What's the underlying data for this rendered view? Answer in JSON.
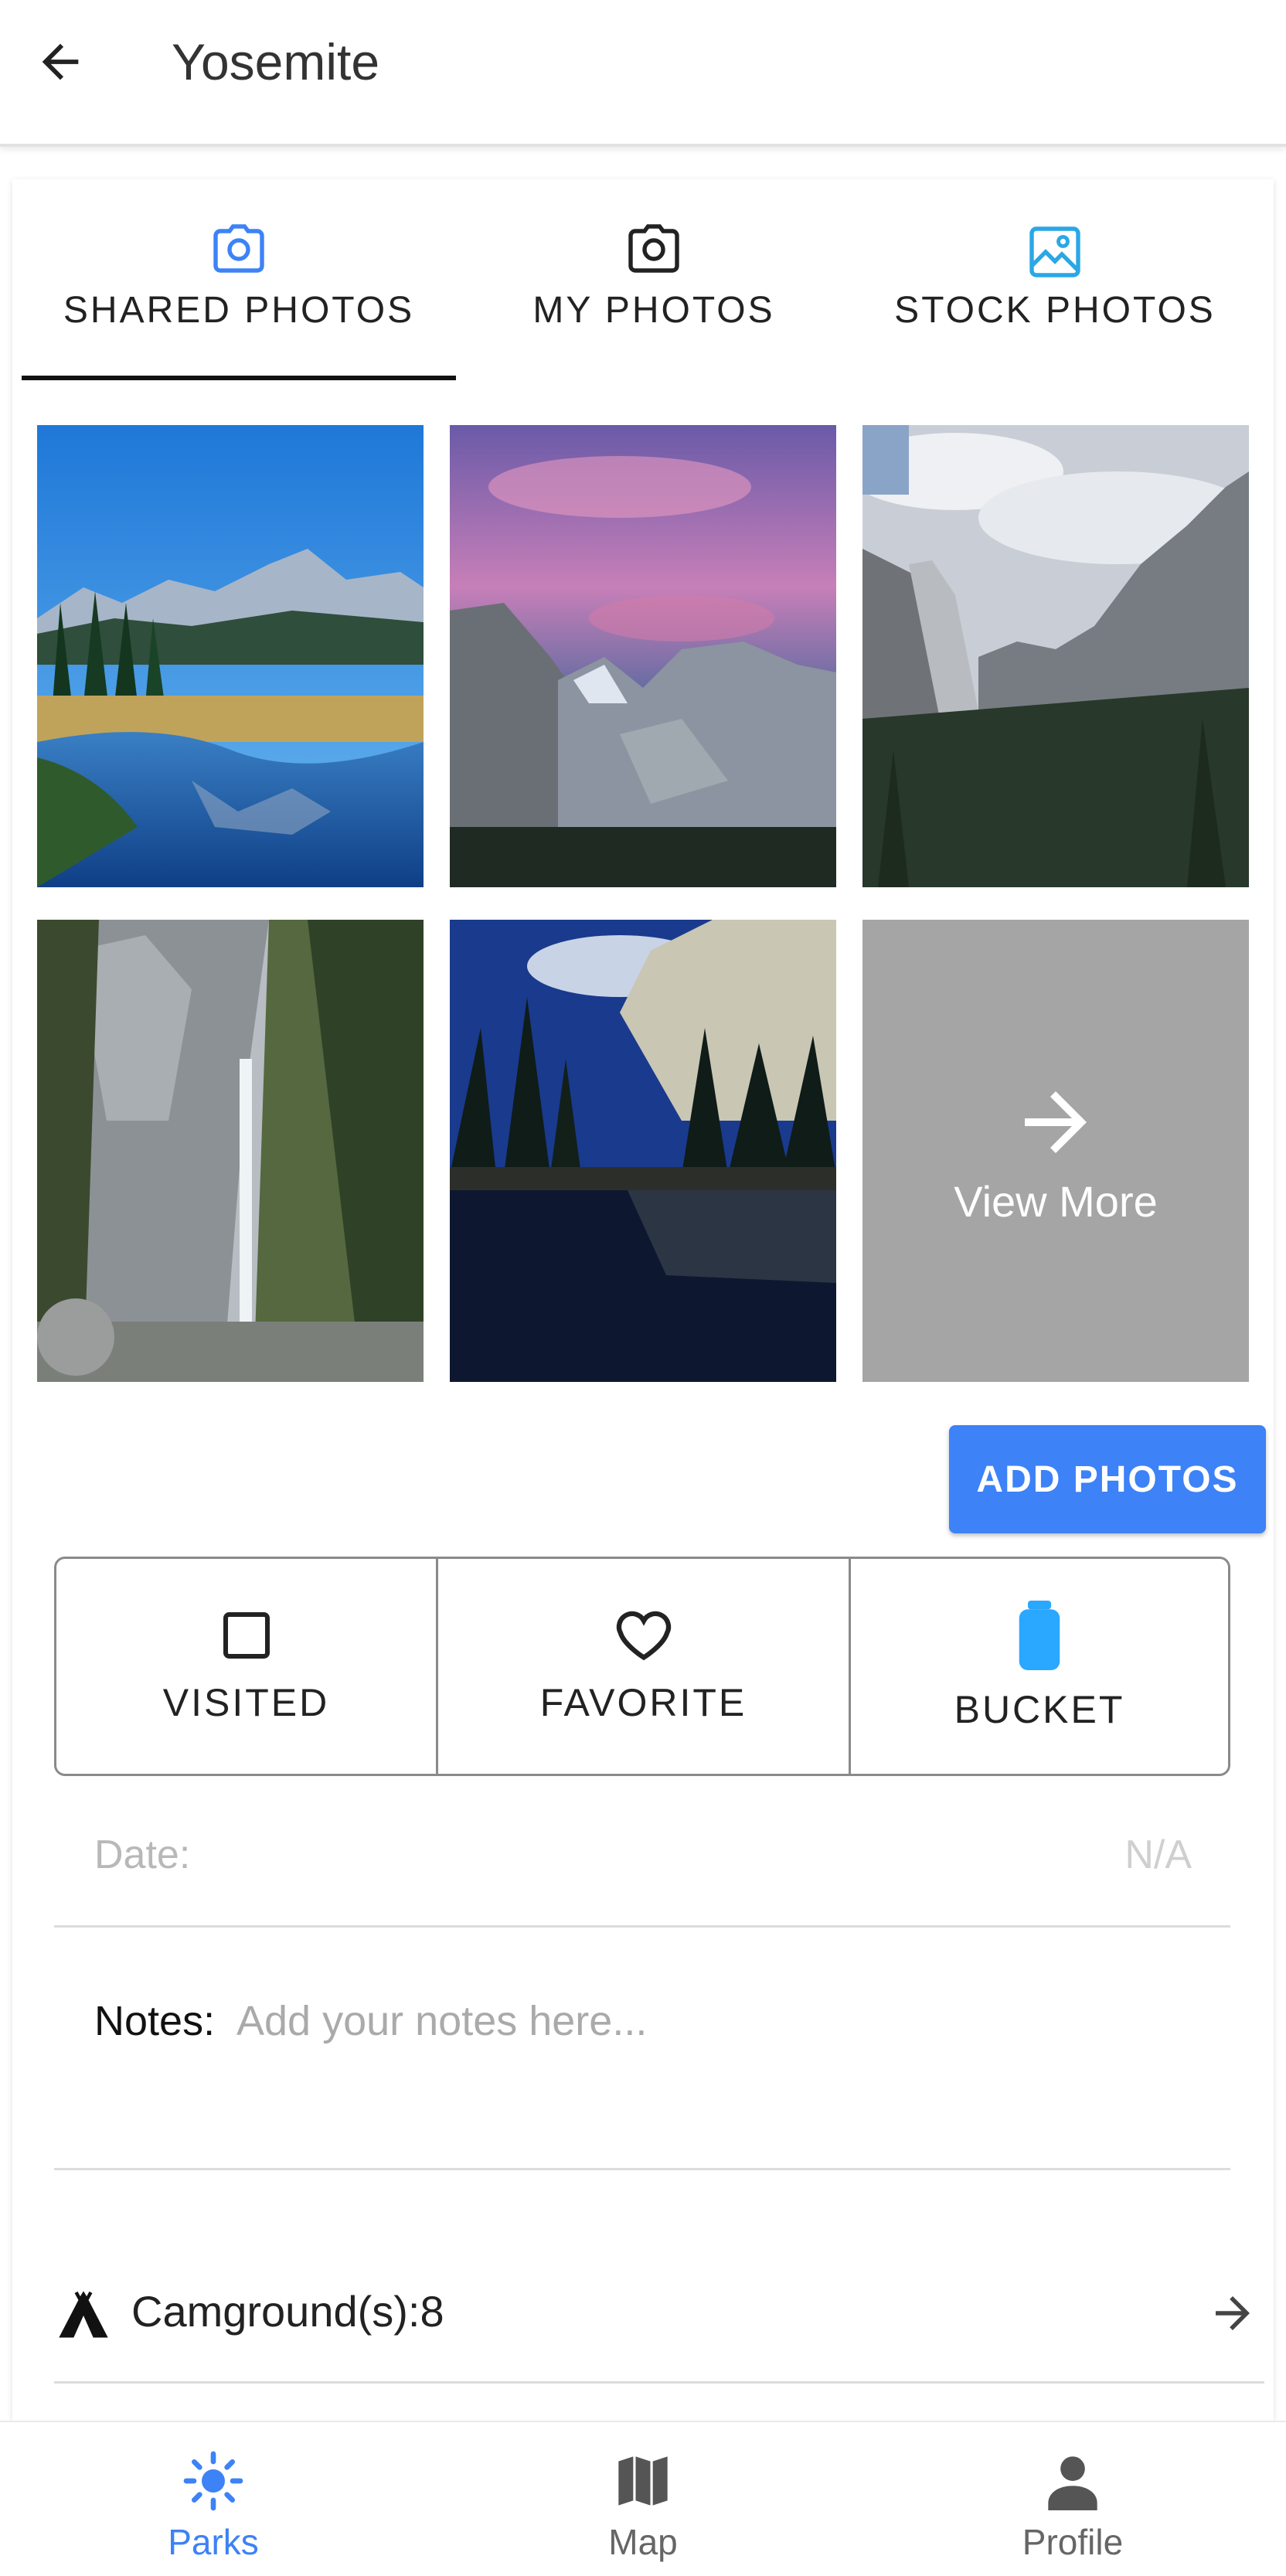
{
  "header": {
    "title": "Yosemite",
    "back_icon": "arrow-left-icon"
  },
  "tabs": [
    {
      "label": "SHARED PHOTOS",
      "icon": "camera-icon",
      "active": true,
      "icon_color": "#3d82f6"
    },
    {
      "label": "MY PHOTOS",
      "icon": "camera-icon",
      "active": false,
      "icon_color": "#222222"
    },
    {
      "label": "STOCK PHOTOS",
      "icon": "image-icon",
      "active": false,
      "icon_color": "#2aa7e6"
    }
  ],
  "photos": [
    {
      "name": "meadow-lake-reflection"
    },
    {
      "name": "pink-sky-granite-domes"
    },
    {
      "name": "valley-cloudy-view"
    },
    {
      "name": "waterfall-cliffs"
    },
    {
      "name": "el-capitan-reflection"
    }
  ],
  "view_more": {
    "label": "View More",
    "icon": "arrow-right-icon"
  },
  "add_photos": {
    "label": "ADD PHOTOS"
  },
  "toggles": [
    {
      "label": "VISITED",
      "icon": "checkbox-empty-icon"
    },
    {
      "label": "FAVORITE",
      "icon": "heart-outline-icon"
    },
    {
      "label": "BUCKET",
      "icon": "bucket-icon",
      "icon_color": "#2aa7ff"
    }
  ],
  "date": {
    "label": "Date:",
    "value": "N/A"
  },
  "notes": {
    "label": "Notes:",
    "placeholder": "Add your notes here..."
  },
  "campground": {
    "text": "Camground(s):8",
    "icon": "tent-icon",
    "arrow_icon": "arrow-right-icon"
  },
  "bottom_nav": [
    {
      "label": "Parks",
      "icon": "sun-icon",
      "active": true
    },
    {
      "label": "Map",
      "icon": "map-icon",
      "active": false
    },
    {
      "label": "Profile",
      "icon": "person-icon",
      "active": false
    }
  ],
  "colors": {
    "accent": "#3d82f6",
    "view_more_bg": "#a5a5a5",
    "divider": "#dcdcdc"
  }
}
